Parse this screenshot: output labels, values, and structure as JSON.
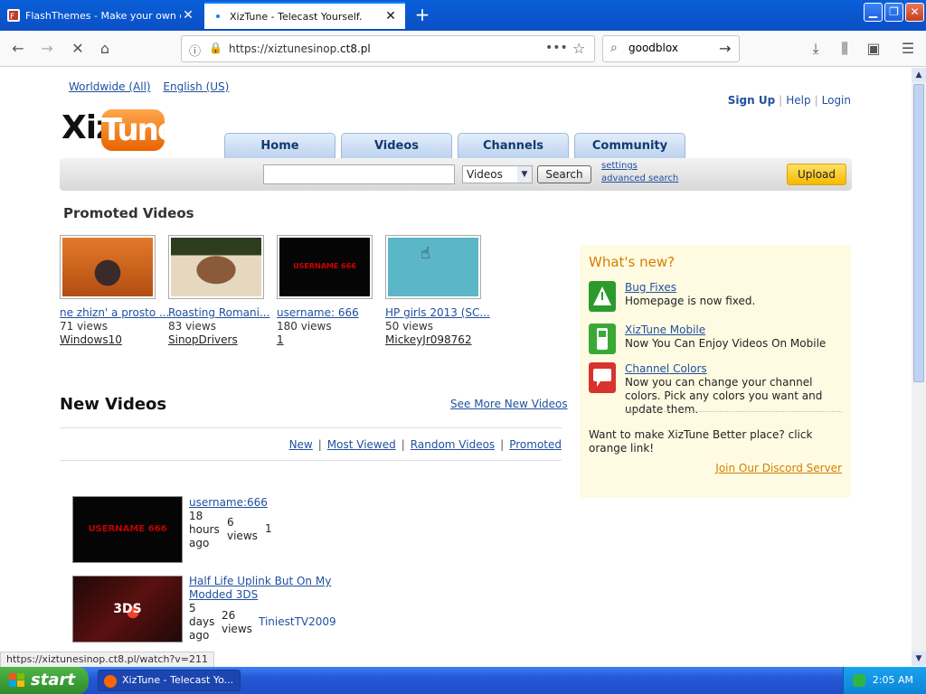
{
  "browser": {
    "tabs": [
      {
        "title": "FlashThemes - Make your own ca",
        "active": false
      },
      {
        "title": "XizTune - Telecast Yourself.",
        "active": true
      }
    ],
    "url_prefix": "https://xiztunesinop.",
    "url_host": "ct8.pl",
    "search_value": "goodblox",
    "status_url": "https://xiztunesinop.ct8.pl/watch?v=211"
  },
  "site": {
    "top_links": [
      "Worldwide (All)",
      "English (US)"
    ],
    "account": {
      "signup": "Sign Up",
      "help": "Help",
      "login": "Login"
    },
    "logo": {
      "left": "Xiz",
      "right": "Tune"
    },
    "nav": [
      "Home",
      "Videos",
      "Channels",
      "Community"
    ],
    "search": {
      "category": "Videos",
      "button": "Search",
      "settings": "settings",
      "advanced": "advanced search",
      "upload": "Upload"
    }
  },
  "promoted": {
    "title": "Promoted Videos",
    "videos": [
      {
        "title": "ne zhizn' a prosto ...",
        "views": "71 views",
        "user": "Windows10"
      },
      {
        "title": "Roasting Romani...",
        "views": "83 views",
        "user": "SinopDrivers"
      },
      {
        "title": "username: 666",
        "views": "180 views",
        "user": "1",
        "thumb_text": "USERNAME 666"
      },
      {
        "title": "HP girls 2013 (SC...",
        "views": "50 views",
        "user": "MickeyJr098762"
      }
    ]
  },
  "new_videos": {
    "title": "New Videos",
    "see_more": "See More New Videos",
    "filters": [
      "New",
      "Most Viewed",
      "Random Videos",
      "Promoted"
    ],
    "items": [
      {
        "title": "username:666",
        "age_l1": "18",
        "age_l2": "hours",
        "age_l3": "ago",
        "views_l1": "6",
        "views_l2": "views",
        "user": "1",
        "thumb_text": "USERNAME 666"
      },
      {
        "title": "Half Life Uplink But On My Modded 3DS",
        "age_l1": "5",
        "age_l2": "days",
        "age_l3": "ago",
        "views_l1": "26",
        "views_l2": "views",
        "user": "TiniestTV2009",
        "thumb_text": "3DS"
      }
    ]
  },
  "whatsnew": {
    "title": "What's new?",
    "items": [
      {
        "title": "Bug Fixes",
        "desc": "Homepage is now fixed."
      },
      {
        "title": "XizTune Mobile",
        "desc": "Now You Can Enjoy Videos On Mobile"
      },
      {
        "title": "Channel Colors",
        "desc": "Now you can change your channel colors. Pick any colors you want and update them."
      }
    ],
    "footer": "Want to make XizTune Better place? click orange link!",
    "discord": "Join Our Discord Server"
  },
  "taskbar": {
    "start": "start",
    "item": "XizTune - Telecast Yo...",
    "clock": "2:05 AM"
  }
}
